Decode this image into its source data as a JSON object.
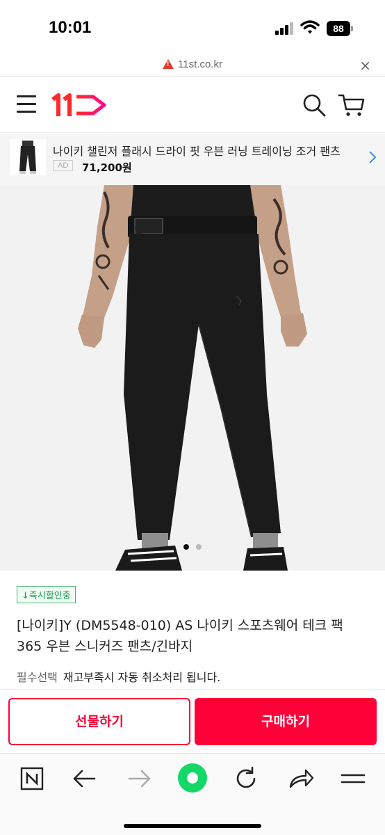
{
  "status_bar": {
    "time": "10:01",
    "battery": "88"
  },
  "url_bar": {
    "domain": "11st.co.kr",
    "icons": [
      "warning-icon",
      "close-icon"
    ]
  },
  "header": {
    "logo_text": "11",
    "icons": [
      "hamburger-menu-icon",
      "search-icon",
      "cart-icon"
    ],
    "brand_color": "#ff0038"
  },
  "ad_product": {
    "title": "나이키 챌린저 플래시 드라이 핏 우븐 러닝 트레이닝 조거 팬츠",
    "ad_label": "AD",
    "price": "71,200원"
  },
  "gallery": {
    "total_slides": 2,
    "active_slide": 1
  },
  "product": {
    "badge": "↓즉시할인중",
    "title": "[나이키]Y (DM5548-010) AS 나이키 스포츠웨어 테크 팩 365 우븐 스니커즈 팬츠/긴바지",
    "option_label": "필수선택",
    "option_text": "재고부족시 자동 취소처리 됩니다."
  },
  "actions": {
    "gift_label": "선물하기",
    "buy_label": "구매하기"
  },
  "browser_toolbar": {
    "icons": [
      "naver-n-icon",
      "back-arrow-icon",
      "forward-arrow-icon",
      "green-home-icon",
      "refresh-icon",
      "share-icon",
      "menu-icon"
    ]
  }
}
